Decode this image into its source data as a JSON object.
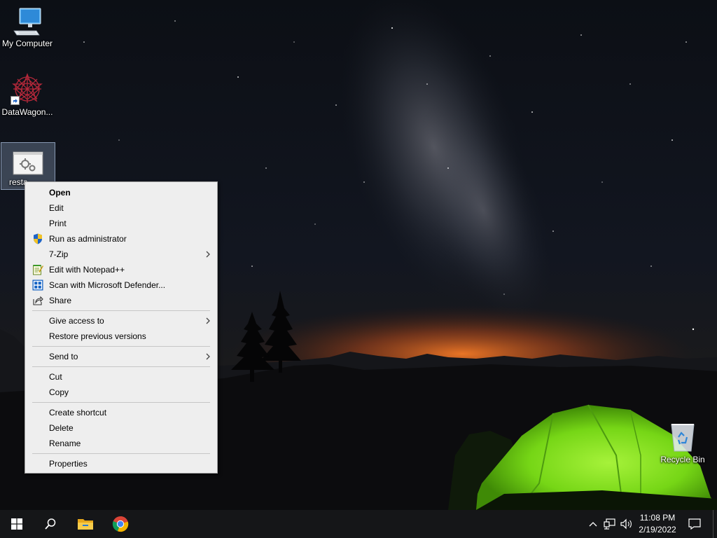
{
  "desktop": {
    "icons": {
      "my_computer": "My Computer",
      "datawagon": "DataWagon...",
      "selected_file": "resta",
      "recycle_bin": "Recycle Bin"
    }
  },
  "context_menu": {
    "items": {
      "open": "Open",
      "edit": "Edit",
      "print": "Print",
      "run_as_admin": "Run as administrator",
      "zip": "7-Zip",
      "notepadpp": "Edit with Notepad++",
      "defender": "Scan with Microsoft Defender...",
      "share": "Share",
      "give_access": "Give access to",
      "restore_versions": "Restore previous versions",
      "send_to": "Send to",
      "cut": "Cut",
      "copy": "Copy",
      "create_shortcut": "Create shortcut",
      "delete": "Delete",
      "rename": "Rename",
      "properties": "Properties"
    },
    "submenu_items": [
      "7-Zip",
      "Give access to",
      "Send to"
    ],
    "default_item": "Open"
  },
  "taskbar": {
    "pinned": [
      "windows-start-icon",
      "search-icon",
      "file-explorer-icon",
      "chrome-icon"
    ],
    "tray": [
      "chevron-up-icon",
      "network-icon",
      "volume-icon",
      "notification-icon"
    ],
    "clock": {
      "time": "11:08 PM",
      "date": "2/19/2022"
    }
  },
  "colors": {
    "menu_background": "#eeeeee",
    "taskbar": "#151618",
    "tent_green": "#7ee01a",
    "horizon_orange": "#e8621c"
  }
}
